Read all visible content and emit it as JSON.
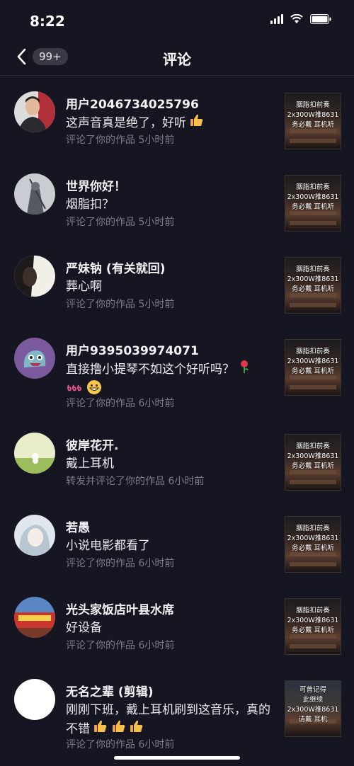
{
  "status_bar": {
    "time": "8:22"
  },
  "nav": {
    "badge": "99+",
    "title": "评论"
  },
  "comments": [
    {
      "name": "用户2046734025796",
      "text": "这声音真是绝了，好听",
      "meta": "评论了你的作品  5小时前",
      "thumb": "胭脂扣前奏\n2x300W推8631\n务必戴  耳机听"
    },
    {
      "name": "世界你好！",
      "text": "烟脂扣？",
      "meta": "评论了你的作品  5小时前",
      "thumb": "胭脂扣前奏\n2x300W推8631\n务必戴  耳机听"
    },
    {
      "name": "严妹钠 (有关就回)",
      "text": "葬心啊",
      "meta": "评论了你的作品  5小时前",
      "thumb": "胭脂扣前奏\n2x300W推8631\n务必戴  耳机听"
    },
    {
      "name": "用户9395039974071",
      "text": "直接撸小提琴不如这个好听吗？",
      "meta": "评论了你的作品  6小时前",
      "thumb": "胭脂扣前奏\n2x300W推8631\n务必戴  耳机听"
    },
    {
      "name": "彼岸花开.",
      "text": "戴上耳机",
      "meta": "转发并评论了你的作品  6小时前",
      "thumb": "胭脂扣前奏\n2x300W推8631\n务必戴  耳机听"
    },
    {
      "name": "若愚",
      "text": "小说电影都看了",
      "meta": "评论了你的作品  6小时前",
      "thumb": "胭脂扣前奏\n2x300W推8631\n务必戴  耳机听"
    },
    {
      "name": "光头家饭店叶县水席",
      "text": "好设备",
      "meta": "评论了你的作品  6小时前",
      "thumb": "胭脂扣前奏\n2x300W推8631\n务必戴  耳机听"
    },
    {
      "name": "无名之辈 (剪辑)",
      "text": "刚刚下班，戴上耳机刷到这音乐，真的不错",
      "meta": "评论了你的作品  6小时前",
      "thumb": "可曾记得\n此继续\n2x300W推8631\n请戴  耳机"
    }
  ],
  "colors": {
    "background": "#161622",
    "meta_text": "#7c7c88",
    "badge_bg": "#3a3a46"
  }
}
